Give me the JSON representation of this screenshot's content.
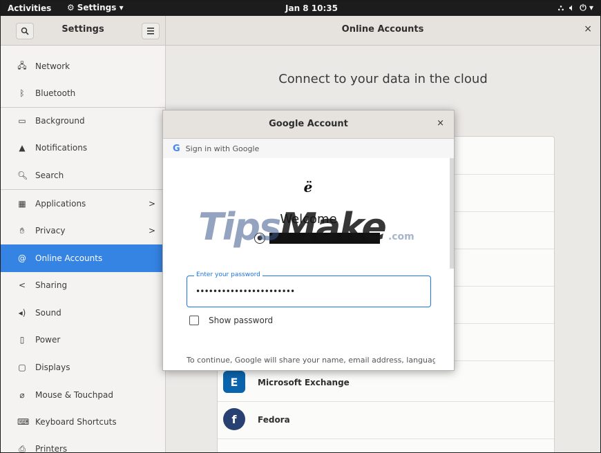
{
  "topbar": {
    "activities": "Activities",
    "app_menu_label": "Settings ▾",
    "clock": "Jan 8  10:35",
    "status_icons": [
      "network-icon",
      "volume-icon",
      "power-icon"
    ]
  },
  "header": {
    "left_title": "Settings",
    "right_title": "Online Accounts",
    "close_glyph": "×"
  },
  "sidebar": {
    "items": [
      {
        "label": "Network",
        "icon": "network-icon"
      },
      {
        "label": "Bluetooth",
        "icon": "bluetooth-icon"
      },
      {
        "label": "Background",
        "icon": "background-icon"
      },
      {
        "label": "Notifications",
        "icon": "notifications-icon"
      },
      {
        "label": "Search",
        "icon": "search-icon"
      },
      {
        "label": "Applications",
        "icon": "applications-icon"
      },
      {
        "label": "Privacy",
        "icon": "privacy-icon"
      },
      {
        "label": "Online Accounts",
        "icon": "online-accounts-icon"
      },
      {
        "label": "Sharing",
        "icon": "sharing-icon"
      },
      {
        "label": "Sound",
        "icon": "sound-icon"
      },
      {
        "label": "Power",
        "icon": "power-icon"
      },
      {
        "label": "Displays",
        "icon": "displays-icon"
      },
      {
        "label": "Mouse & Touchpad",
        "icon": "mouse-icon"
      },
      {
        "label": "Keyboard Shortcuts",
        "icon": "keyboard-icon"
      },
      {
        "label": "Printers",
        "icon": "printer-icon"
      }
    ],
    "active": "Online Accounts"
  },
  "main": {
    "heading": "Connect to your data in the cloud",
    "providers": [
      {
        "label": "Microsoft Exchange",
        "icon": "exchange-icon",
        "color": "#0a64ad"
      },
      {
        "label": "Fedora",
        "icon": "fedora-icon",
        "color": "#294172"
      }
    ]
  },
  "dialog": {
    "title": "Google Account",
    "close_glyph": "×",
    "sign_in_text": "Sign in with Google",
    "welcome": "Welcome",
    "password_label": "Enter your password",
    "password_value": "•••••••••••••••••••••••",
    "show_password": "Show password",
    "notice": "To continue, Google will share your name, email address, language"
  },
  "watermark": {
    "text1": "Tips",
    "text2": "Make",
    "text3": ".com"
  },
  "colors": {
    "accent": "#3584e4",
    "google_blue": "#1a73e8"
  }
}
